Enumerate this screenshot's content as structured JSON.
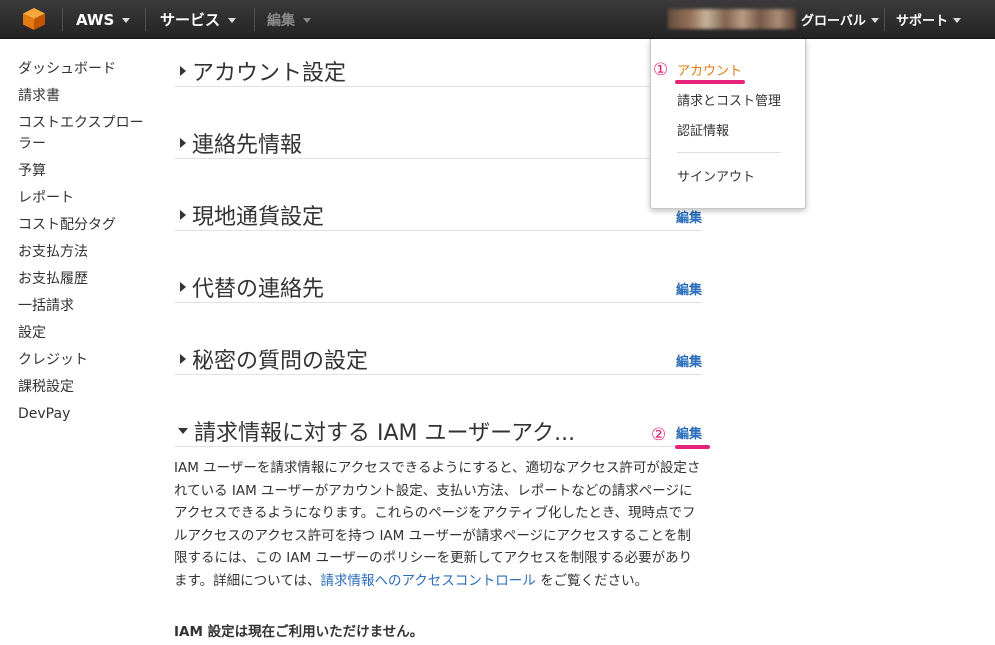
{
  "topbar": {
    "brand": "AWS",
    "services": "サービス",
    "edit": "編集",
    "region": "グローバル",
    "support": "サポート"
  },
  "sidebar": {
    "items": [
      {
        "label": "ダッシュボード"
      },
      {
        "label": "請求書"
      },
      {
        "label": "コストエクスプローラー"
      },
      {
        "label": "予算"
      },
      {
        "label": "レポート"
      },
      {
        "label": "コスト配分タグ"
      },
      {
        "label": "お支払方法"
      },
      {
        "label": "お支払履歴"
      },
      {
        "label": "一括請求"
      },
      {
        "label": "設定"
      },
      {
        "label": "クレジット"
      },
      {
        "label": "課税設定"
      },
      {
        "label": "DevPay"
      }
    ]
  },
  "sections": [
    {
      "title": "アカウント設定",
      "edit": ""
    },
    {
      "title": "連絡先情報",
      "edit": ""
    },
    {
      "title": "現地通貨設定",
      "edit": "編集"
    },
    {
      "title": "代替の連絡先",
      "edit": "編集"
    },
    {
      "title": "秘密の質問の設定",
      "edit": "編集"
    },
    {
      "title": "請求情報に対する IAM ユーザーアク...",
      "edit": "編集"
    }
  ],
  "iam": {
    "text_before": "IAM ユーザーを請求情報にアクセスできるようにすると、適切なアクセス許可が設定されている IAM ユーザーがアカウント設定、支払い方法、レポートなどの請求ページにアクセスできるようになります。これらのページをアクティブ化したとき、現時点でフルアクセスのアクセス許可を持つ IAM ユーザーが請求ページにアクセスすることを制限するには、この IAM ユーザーのポリシーを更新してアクセスを制限する必要があります。詳細については、",
    "link": "請求情報へのアクセスコントロール",
    "text_after": " をご覧ください。",
    "note": "IAM 設定は現在ご利用いただけません。"
  },
  "dropdown": {
    "items": [
      {
        "label": "アカウント"
      },
      {
        "label": "請求とコスト管理"
      },
      {
        "label": "認証情報"
      },
      {
        "label": "サインアウト"
      }
    ]
  },
  "annotations": {
    "one": "①",
    "two": "②"
  },
  "colors": {
    "accent_orange": "#e47911",
    "link_blue": "#2a6ebb",
    "annotation_pink": "#e6237a",
    "topbar": "#2b2b2b"
  }
}
